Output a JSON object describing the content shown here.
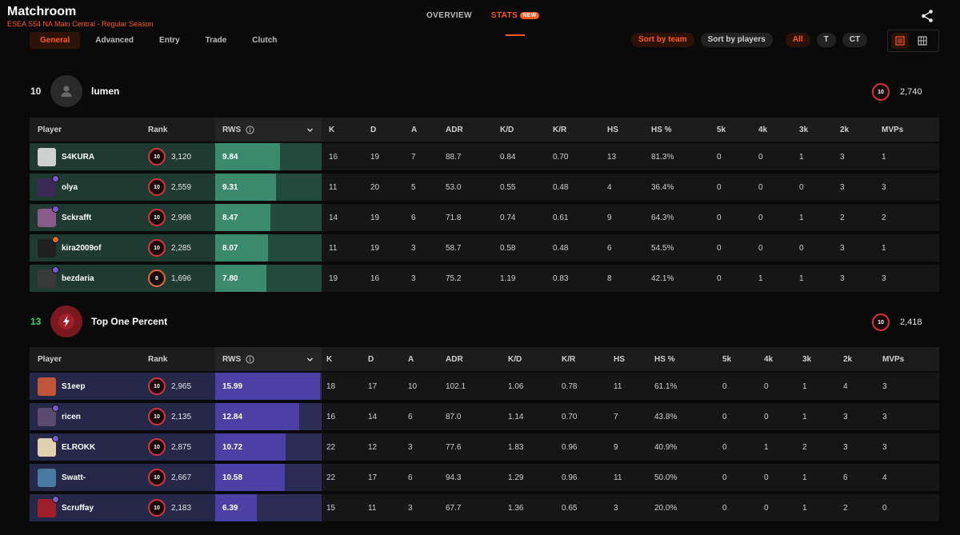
{
  "header": {
    "title": "Matchroom",
    "subtitle": "ESEA S54 NA Main Central - Regular Season",
    "nav": [
      {
        "label": "OVERVIEW"
      },
      {
        "label": "STATS",
        "badge": "NEW"
      }
    ]
  },
  "tabs": [
    "General",
    "Advanced",
    "Entry",
    "Trade",
    "Clutch"
  ],
  "filters": {
    "sort_team": "Sort by team",
    "sort_players": "Sort by players",
    "sides": [
      "All",
      "T",
      "CT"
    ]
  },
  "columns": [
    "Player",
    "Rank",
    "RWS",
    "K",
    "D",
    "A",
    "ADR",
    "K/D",
    "K/R",
    "HS",
    "HS %",
    "5k",
    "4k",
    "3k",
    "2k",
    "MVPs"
  ],
  "colors": {
    "accent": "#ff5a1f",
    "win": "#38d46a",
    "team1_bar": "#3b8a6e",
    "team2_bar": "#4c3fa6"
  },
  "teams": [
    {
      "score": "10",
      "name": "lumen",
      "elo": "2,740",
      "level": "10",
      "rws_max": 15.99,
      "players": [
        {
          "name": "S4KURA",
          "level": "10",
          "elo": "3,120",
          "rws": "9.84",
          "k": "16",
          "d": "19",
          "a": "7",
          "adr": "88.7",
          "kd": "0.84",
          "kr": "0.70",
          "hs": "13",
          "hsp": "81.3%",
          "k5": "0",
          "k4": "0",
          "k3": "1",
          "k2": "3",
          "mvps": "1"
        },
        {
          "name": "olya",
          "level": "10",
          "elo": "2,559",
          "rws": "9.31",
          "k": "11",
          "d": "20",
          "a": "5",
          "adr": "53.0",
          "kd": "0.55",
          "kr": "0.48",
          "hs": "4",
          "hsp": "36.4%",
          "k5": "0",
          "k4": "0",
          "k3": "0",
          "k2": "3",
          "mvps": "3"
        },
        {
          "name": "Sckrafft",
          "level": "10",
          "elo": "2,998",
          "rws": "8.47",
          "k": "14",
          "d": "19",
          "a": "6",
          "adr": "71.8",
          "kd": "0.74",
          "kr": "0.61",
          "hs": "9",
          "hsp": "64.3%",
          "k5": "0",
          "k4": "0",
          "k3": "1",
          "k2": "2",
          "mvps": "2"
        },
        {
          "name": "kira2009of",
          "level": "10",
          "elo": "2,285",
          "rws": "8.07",
          "k": "11",
          "d": "19",
          "a": "3",
          "adr": "58.7",
          "kd": "0.58",
          "kr": "0.48",
          "hs": "6",
          "hsp": "54.5%",
          "k5": "0",
          "k4": "0",
          "k3": "0",
          "k2": "3",
          "mvps": "1"
        },
        {
          "name": "bezdaria",
          "level": "8",
          "elo": "1,696",
          "rws": "7.80",
          "k": "19",
          "d": "16",
          "a": "3",
          "adr": "75.2",
          "kd": "1.19",
          "kr": "0.83",
          "hs": "8",
          "hsp": "42.1%",
          "k5": "0",
          "k4": "1",
          "k3": "1",
          "k2": "3",
          "mvps": "3"
        }
      ]
    },
    {
      "score": "13",
      "name": "Top One Percent",
      "elo": "2,418",
      "level": "10",
      "rws_max": 15.99,
      "players": [
        {
          "name": "S1eep",
          "level": "10",
          "elo": "2,965",
          "rws": "15.99",
          "k": "18",
          "d": "17",
          "a": "10",
          "adr": "102.1",
          "kd": "1.06",
          "kr": "0.78",
          "hs": "11",
          "hsp": "61.1%",
          "k5": "0",
          "k4": "0",
          "k3": "1",
          "k2": "4",
          "mvps": "3"
        },
        {
          "name": "ricen",
          "level": "10",
          "elo": "2,135",
          "rws": "12.84",
          "k": "16",
          "d": "14",
          "a": "6",
          "adr": "87.0",
          "kd": "1.14",
          "kr": "0.70",
          "hs": "7",
          "hsp": "43.8%",
          "k5": "0",
          "k4": "0",
          "k3": "1",
          "k2": "3",
          "mvps": "3"
        },
        {
          "name": "ELROKK",
          "level": "10",
          "elo": "2,875",
          "rws": "10.72",
          "k": "22",
          "d": "12",
          "a": "3",
          "adr": "77.6",
          "kd": "1.83",
          "kr": "0.96",
          "hs": "9",
          "hsp": "40.9%",
          "k5": "0",
          "k4": "1",
          "k3": "2",
          "k2": "3",
          "mvps": "3"
        },
        {
          "name": "Swatt-",
          "level": "10",
          "elo": "2,667",
          "rws": "10.58",
          "k": "22",
          "d": "17",
          "a": "6",
          "adr": "94.3",
          "kd": "1.29",
          "kr": "0.96",
          "hs": "11",
          "hsp": "50.0%",
          "k5": "0",
          "k4": "0",
          "k3": "1",
          "k2": "6",
          "mvps": "4"
        },
        {
          "name": "Scruffay",
          "level": "10",
          "elo": "2,183",
          "rws": "6.39",
          "k": "15",
          "d": "11",
          "a": "3",
          "adr": "67.7",
          "kd": "1.36",
          "kr": "0.65",
          "hs": "3",
          "hsp": "20.0%",
          "k5": "0",
          "k4": "0",
          "k3": "1",
          "k2": "2",
          "mvps": "0"
        }
      ]
    }
  ]
}
